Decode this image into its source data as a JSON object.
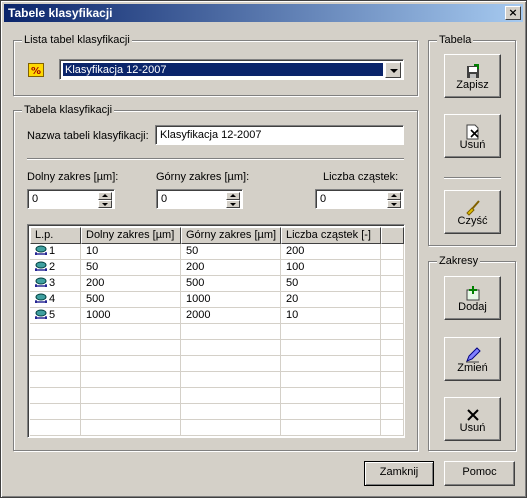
{
  "window": {
    "title": "Tabele klasyfikacji",
    "close_glyph": "×"
  },
  "lista": {
    "group_title": "Lista tabel klasyfikacji",
    "icon": "percent-table-icon",
    "selected": "Klasyfikacja 12-2007"
  },
  "tabela_klas": {
    "group_title": "Tabela klasyfikacji",
    "name_label": "Nazwa tabeli klasyfikacji:",
    "name_value": "Klasyfikacja 12-2007",
    "dolny_label": "Dolny zakres [µm]:",
    "dolny_value": "0",
    "gorny_label": "Górny zakres [µm]:",
    "gorny_value": "0",
    "liczba_label": "Liczba cząstek:",
    "liczba_value": "0"
  },
  "table": {
    "headers": [
      "L.p.",
      "Dolny zakres [µm]",
      "Górny zakres [µm]",
      "Liczba cząstek [-]",
      ""
    ],
    "rows": [
      [
        "1",
        "10",
        "50",
        "200"
      ],
      [
        "2",
        "50",
        "200",
        "100"
      ],
      [
        "3",
        "200",
        "500",
        "50"
      ],
      [
        "4",
        "500",
        "1000",
        "20"
      ],
      [
        "5",
        "1000",
        "2000",
        "10"
      ]
    ],
    "row_icon": "range-icon"
  },
  "tabela_group": {
    "title": "Tabela",
    "save_label": "Zapisz",
    "delete_label": "Usuń",
    "clear_label": "Czyść"
  },
  "zakresy_group": {
    "title": "Zakresy",
    "add_label": "Dodaj",
    "change_label": "Zmień",
    "delete_label": "Usuń"
  },
  "footer": {
    "close_label": "Zamknij",
    "help_label": "Pomoc"
  },
  "colors": {
    "title_start": "#0a246a",
    "title_end": "#a6caf0",
    "face": "#d4d0c8",
    "selection": "#0a246a"
  }
}
